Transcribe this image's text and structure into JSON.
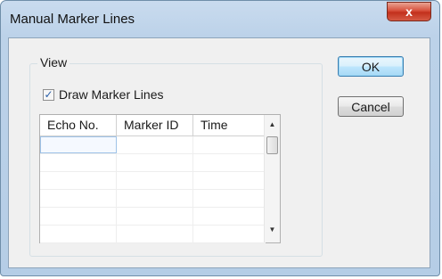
{
  "window": {
    "title": "Manual Marker Lines",
    "close_label": "x"
  },
  "group": {
    "legend": "View"
  },
  "checkbox": {
    "label": "Draw Marker Lines",
    "checked": true,
    "check_glyph": "✓"
  },
  "table": {
    "columns": [
      "Echo No.",
      "Marker ID",
      "Time"
    ],
    "rows": [
      [
        "",
        "",
        ""
      ],
      [
        "",
        "",
        ""
      ],
      [
        "",
        "",
        ""
      ],
      [
        "",
        "",
        ""
      ],
      [
        "",
        "",
        ""
      ],
      [
        "",
        "",
        ""
      ]
    ]
  },
  "scrollbar": {
    "up_glyph": "▲",
    "down_glyph": "▼"
  },
  "buttons": {
    "ok": "OK",
    "cancel": "Cancel"
  }
}
